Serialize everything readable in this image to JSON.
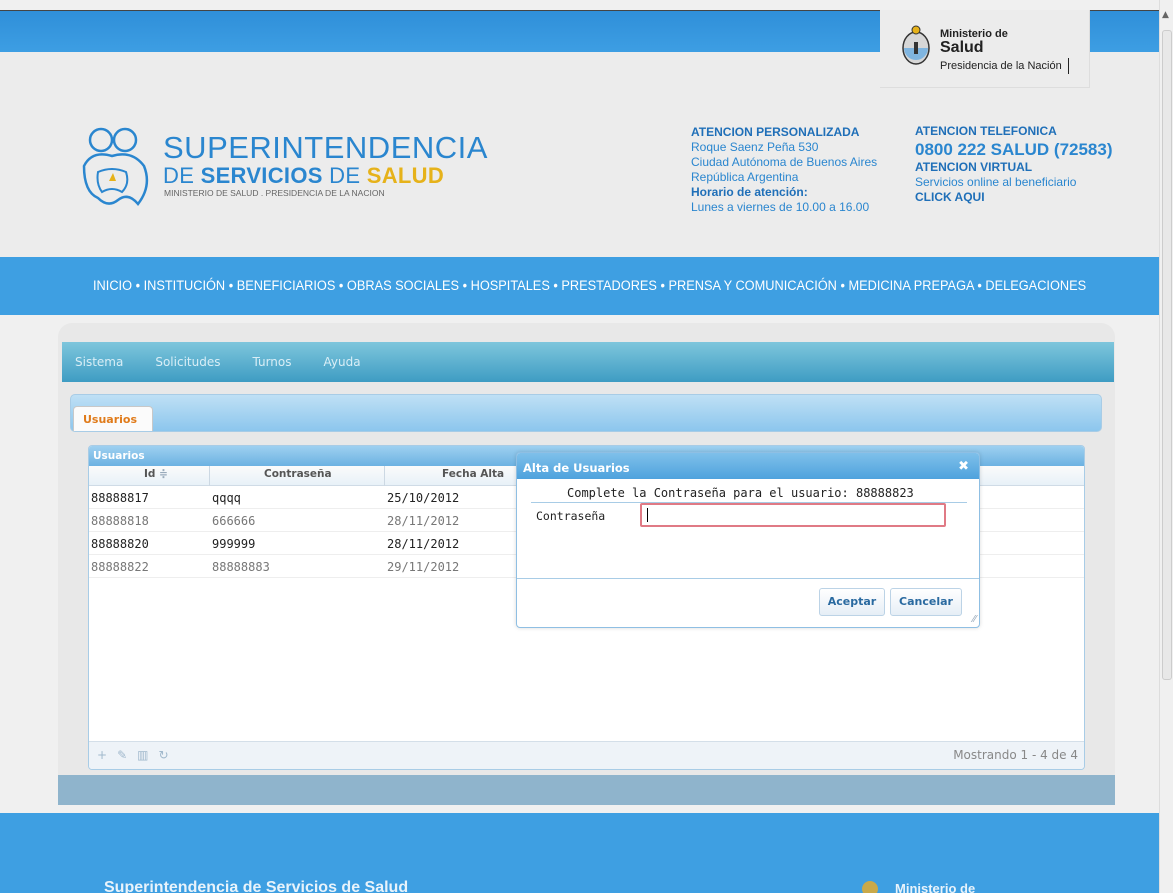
{
  "header": {
    "ministry": {
      "line1": "Ministerio de",
      "line2": "Salud",
      "line3": "Presidencia de la Nación"
    },
    "brand": {
      "line1": "SUPERINTENDENCIA",
      "line2_de": "DE",
      "line2_servicios": "SERVICIOS",
      "line2_de2": "DE",
      "line2_salud": "SALUD",
      "line3": "MINISTERIO DE SALUD . PRESIDENCIA DE LA NACION"
    },
    "attention": {
      "title": "ATENCION PERSONALIZADA",
      "address1": "Roque Saenz Peña 530",
      "address2": "Ciudad Autónoma de Buenos Aires",
      "address3": "República Argentina",
      "hours_label": "Horario de atención:",
      "hours": "Lunes a viernes de 10.00 a 16.00"
    },
    "phone": {
      "title": "ATENCION TELEFONICA",
      "number": "0800 222 SALUD (72583)",
      "virtual_title": "ATENCION VIRTUAL",
      "virtual_text": "Servicios online al beneficiario",
      "click": "CLICK AQUI"
    }
  },
  "nav": {
    "items": [
      "INICIO",
      "INSTITUCIÓN",
      "BENEFICIARIOS",
      "OBRAS SOCIALES",
      "HOSPITALES",
      "PRESTADORES",
      "PRENSA Y COMUNICACIÓN",
      "MEDICINA PREPAGA",
      "DELEGACIONES"
    ],
    "separator": "•"
  },
  "menubar": {
    "items": [
      "Sistema",
      "Solicitudes",
      "Turnos",
      "Ayuda"
    ]
  },
  "tab": {
    "label": "Usuarios"
  },
  "grid": {
    "title": "Usuarios",
    "columns": [
      "Id",
      "Contraseña",
      "Fecha Alta"
    ],
    "sort_icon": "sort-asc-icon",
    "rows": [
      [
        "88888817",
        "qqqq",
        "25/10/2012"
      ],
      [
        "88888818",
        "666666",
        "28/11/2012"
      ],
      [
        "88888820",
        "999999",
        "28/11/2012"
      ],
      [
        "88888822",
        "88888883",
        "29/11/2012"
      ]
    ],
    "footer_count": "Mostrando 1 - 4 de 4"
  },
  "dialog": {
    "title": "Alta de Usuarios",
    "message": "Complete la Contraseña para el usuario: 88888823",
    "field_label": "Contraseña",
    "field_value": "",
    "accept": "Aceptar",
    "cancel": "Cancelar"
  },
  "footer": {
    "org": "Superintendencia de Servicios de Salud",
    "ministry": "Ministerio de"
  },
  "colors": {
    "primary_blue": "#3e9fe2",
    "accent_orange": "#e07b1a",
    "brand_yellow": "#e6b21a"
  }
}
